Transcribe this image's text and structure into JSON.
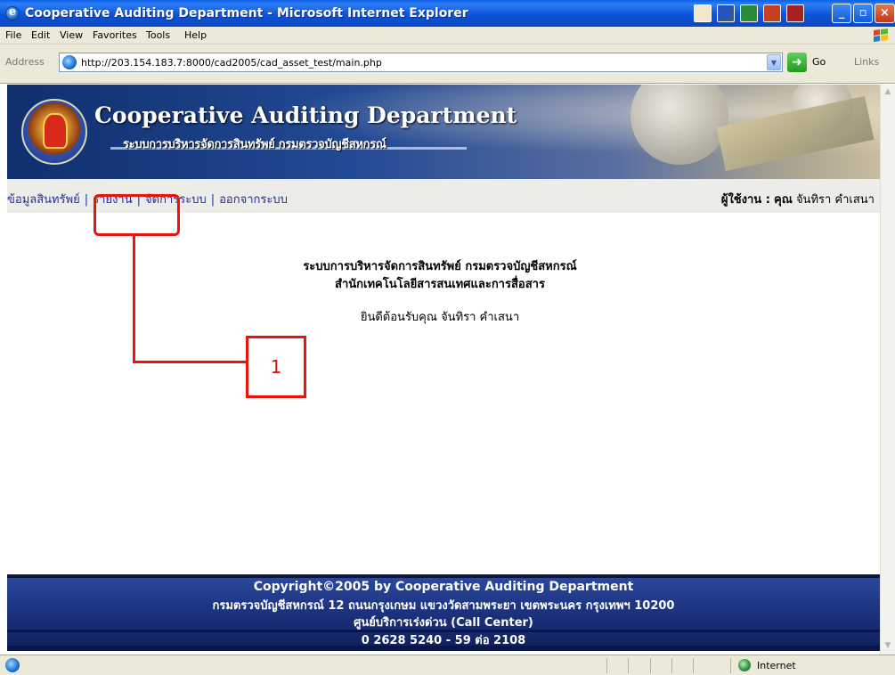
{
  "window": {
    "title": "Cooperative Auditing Department - Microsoft Internet Explorer"
  },
  "menubar": {
    "items": [
      "File",
      "Edit",
      "View",
      "Favorites",
      "Tools",
      "Help"
    ]
  },
  "addressbar": {
    "label": "Address",
    "url": "http://203.154.183.7:8000/cad2005/cad_asset_test/main.php",
    "go_label": "Go",
    "links_label": "Links"
  },
  "banner": {
    "title": "Cooperative Auditing Department",
    "subtitle": "ระบบการบริหารจัดการสินทรัพย์ กรมตรวจบัญชีสหกรณ์"
  },
  "nav": {
    "items": [
      "ข้อมูลสินทรัพย์",
      "รายงาน",
      "จัดการระบบ",
      "ออกจากระบบ"
    ],
    "separator": "|",
    "user_label": "ผู้ใช้งาน :",
    "user_prefix": "คุณ",
    "user_name": "จันทิรา คำเสนา"
  },
  "main": {
    "heading1": "ระบบการบริหารจัดการสินทรัพย์ กรมตรวจบัญชีสหกรณ์",
    "heading2": "สำนักเทคโนโลยีสารสนเทศและการสื่อสาร",
    "welcome": "ยินดีต้อนรับคุณ จันทิรา คำเสนา"
  },
  "footer": {
    "line1": "Copyright©2005 by Cooperative Auditing Department",
    "line2": "กรมตรวจบัญชีสหกรณ์ 12 ถนนกรุงเกษม แขวงวัดสามพระยา เขตพระนคร กรุงเทพฯ 10200",
    "line3": "ศูนย์บริการเร่งด่วน (Call Center)",
    "line4": "0 2628 5240 - 59 ต่อ 2108"
  },
  "annotation": {
    "label": "1"
  },
  "statusbar": {
    "zone": "Internet"
  },
  "colors": {
    "annotation": "#e8140e",
    "link": "#2030a0",
    "footer_bg": "#1d3480"
  }
}
